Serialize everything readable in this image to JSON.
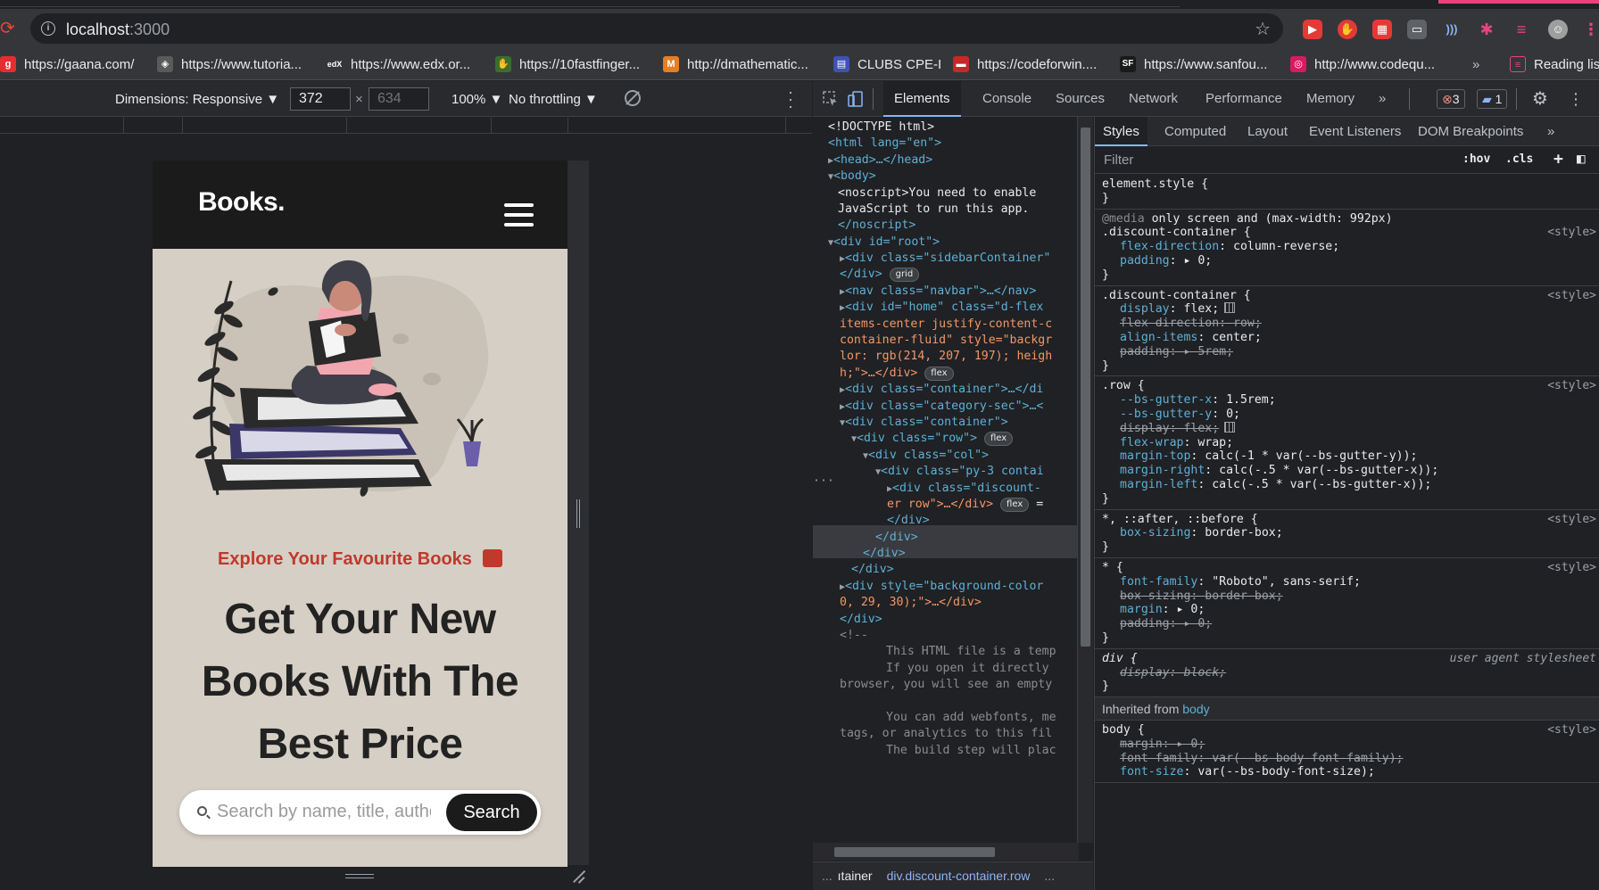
{
  "browser": {
    "url_host": "localhost",
    "url_port": ":3000",
    "bookmarks": [
      {
        "label": "https://gaana.com/",
        "icon": "gaana-icon",
        "color": "#e72c30",
        "glyph": "g"
      },
      {
        "label": "https://www.tutoria...",
        "icon": "tutorialspoint-icon",
        "color": "#5a5a5a",
        "glyph": "◈"
      },
      {
        "label": "https://www.edx.or...",
        "icon": "edx-icon",
        "color": "#35363a",
        "glyph": "edX"
      },
      {
        "label": "https://10fastfinger...",
        "icon": "10fastfingers-icon",
        "color": "#3b6e2e",
        "glyph": "✋"
      },
      {
        "label": "http://dmathematic...",
        "icon": "dmathematics-icon",
        "color": "#e67e22",
        "glyph": "M"
      },
      {
        "label": "CLUBS CPE-I",
        "icon": "clubs-icon",
        "color": "#3f51b5",
        "glyph": "▤"
      },
      {
        "label": "https://codeforwin....",
        "icon": "codeforwin-icon",
        "color": "#c62828",
        "glyph": "▬"
      },
      {
        "label": "https://www.sanfou...",
        "icon": "sanfoundry-icon",
        "color": "#1a1a1a",
        "glyph": "SF"
      },
      {
        "label": "http://www.codequ...",
        "icon": "codequotient-icon",
        "color": "#d81b60",
        "glyph": "◎"
      }
    ],
    "bookmarks_more": "»",
    "reading_list": "Reading list"
  },
  "device_toolbar": {
    "dimensions": "Dimensions: Responsive ▼",
    "width": "372",
    "height": "634",
    "times": "×",
    "zoom": "100% ▼",
    "throttling": "No throttling ▼"
  },
  "page": {
    "logo": "Books.",
    "tagline": "Explore Your Favourite Books",
    "headline": "Get Your New Books With The Best Price",
    "search_placeholder": "Search by name, title, author",
    "search_button": "Search",
    "colors": {
      "background": "#d6cfc5",
      "navbar": "#1b1b1b",
      "accent": "#c0392b"
    }
  },
  "devtools": {
    "tabs": [
      "Elements",
      "Console",
      "Sources",
      "Network",
      "Performance",
      "Memory"
    ],
    "more_tabs": "»",
    "errors": "3",
    "messages": "1",
    "elements_lines": [
      "<!DOCTYPE html>",
      "<html lang=\"en\">",
      "<head>…</head>",
      "<body>",
      "<noscript>You need to enable",
      "JavaScript to run this app.",
      "</noscript>",
      "<div id=\"root\">",
      "<div class=\"sidebarContainer\"",
      "</div>",
      "<nav class=\"navbar\">…</nav>",
      "<div id=\"home\" class=\"d-flex",
      "items-center justify-content-c",
      "container-fluid\" style=\"backgr",
      "lor: rgb(214, 207, 197); heigh",
      "h;\">…</div>",
      "<div class=\"container\">…</di",
      "<div class=\"category-sec\">…<",
      "<div class=\"container\">",
      "<div class=\"row\">",
      "<div class=\"col\">",
      "<div class=\"py-3 contai",
      "<div class=\"discount-",
      "er row\">…</div>",
      "</div>",
      "</div>",
      "</div>",
      "</div>",
      "<div style=\"background-color",
      "0, 29, 30);\">…</div>",
      "</div>",
      "<!--",
      "This HTML file is a temp",
      "If you open it directly",
      "browser, you will see an empty",
      "You can add webfonts, me",
      "tags, or analytics to this fil",
      "The build step will plac"
    ],
    "pills": {
      "grid": "grid",
      "flex": "flex"
    },
    "breadcrumb": [
      "...",
      "ıtainer",
      "div.discount-container.row",
      "..."
    ],
    "styles_tabs": [
      "Styles",
      "Computed",
      "Layout",
      "Event Listeners",
      "DOM Breakpoints"
    ],
    "styles_more": "»",
    "filter_placeholder": "Filter",
    "hov": ":hov",
    "cls": ".cls",
    "add": "+",
    "rules": [
      {
        "selector": "element.style {",
        "source": "",
        "props": []
      },
      {
        "media": "@media only screen and (max-width: 992px)",
        "selector": ".discount-container {",
        "source": "<style>",
        "props": [
          {
            "name": "flex-direction",
            "value": "column-reverse;",
            "strike": false
          },
          {
            "name": "padding",
            "value": "▸ 0;",
            "strike": false
          }
        ]
      },
      {
        "selector": ".discount-container {",
        "source": "<style>",
        "props": [
          {
            "name": "display",
            "value": "flex;",
            "strike": false
          },
          {
            "name": "flex-direction",
            "value": "row;",
            "strike": true
          },
          {
            "name": "align-items",
            "value": "center;",
            "strike": false
          },
          {
            "name": "padding",
            "value": "▸ 5rem;",
            "strike": true
          }
        ]
      },
      {
        "selector": ".row {",
        "source": "<style>",
        "props": [
          {
            "name": "--bs-gutter-x",
            "value": "1.5rem;",
            "strike": false
          },
          {
            "name": "--bs-gutter-y",
            "value": "0;",
            "strike": false
          },
          {
            "name": "display",
            "value": "flex;",
            "strike": true
          },
          {
            "name": "flex-wrap",
            "value": "wrap;",
            "strike": false
          },
          {
            "name": "margin-top",
            "value": "calc(-1 * var(--bs-gutter-y));",
            "strike": false
          },
          {
            "name": "margin-right",
            "value": "calc(-.5 * var(--bs-gutter-x));",
            "strike": false
          },
          {
            "name": "margin-left",
            "value": "calc(-.5 * var(--bs-gutter-x));",
            "strike": false
          }
        ]
      },
      {
        "selector": "*, ::after, ::before {",
        "source": "<style>",
        "props": [
          {
            "name": "box-sizing",
            "value": "border-box;",
            "strike": false
          }
        ]
      },
      {
        "selector": "* {",
        "source": "<style>",
        "props": [
          {
            "name": "font-family",
            "value": "\"Roboto\", sans-serif;",
            "strike": false
          },
          {
            "name": "box-sizing",
            "value": "border-box;",
            "strike": true
          },
          {
            "name": "margin",
            "value": "▸ 0;",
            "strike": false
          },
          {
            "name": "padding",
            "value": "▸ 0;",
            "strike": true
          }
        ]
      },
      {
        "selector": "div {",
        "source": "user agent stylesheet",
        "props": [
          {
            "name": "display",
            "value": "block;",
            "strike": true
          }
        ]
      }
    ],
    "inherited_label": "Inherited from",
    "inherited_from": "body",
    "body_rule": {
      "selector": "body {",
      "source": "<style>",
      "props": [
        {
          "name": "margin",
          "value": "▸ 0;",
          "strike": true
        },
        {
          "name": "font-family",
          "value": "var(--bs-body-font-family);",
          "strike": true
        },
        {
          "name": "font-size",
          "value": "var(--bs-body-font-size);",
          "strike": false
        }
      ]
    }
  }
}
